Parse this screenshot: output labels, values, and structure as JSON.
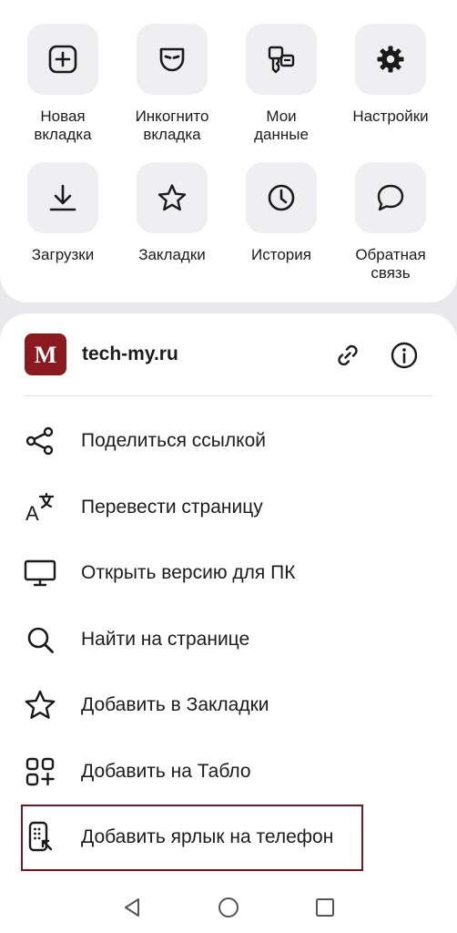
{
  "quick_actions": [
    {
      "label": "Новая\nвкладка",
      "icon": "plus-square-icon"
    },
    {
      "label": "Инкогнито\nвкладка",
      "icon": "mask-icon"
    },
    {
      "label": "Мои\nданные",
      "icon": "key-card-icon"
    },
    {
      "label": "Настройки",
      "icon": "gear-icon"
    },
    {
      "label": "Загрузки",
      "icon": "download-icon"
    },
    {
      "label": "Закладки",
      "icon": "star-icon"
    },
    {
      "label": "История",
      "icon": "clock-icon"
    },
    {
      "label": "Обратная\nсвязь",
      "icon": "chat-bubble-icon"
    }
  ],
  "site": {
    "name": "tech-my.ru",
    "favicon_letter": "M",
    "favicon_color": "#8b1a1f"
  },
  "menu": [
    {
      "label": "Поделиться ссылкой",
      "icon": "share-icon"
    },
    {
      "label": "Перевести страницу",
      "icon": "translate-icon"
    },
    {
      "label": "Открыть версию для ПК",
      "icon": "desktop-icon"
    },
    {
      "label": "Найти на странице",
      "icon": "search-icon"
    },
    {
      "label": "Добавить в Закладки",
      "icon": "star-outline-icon"
    },
    {
      "label": "Добавить на Табло",
      "icon": "grid-add-icon"
    },
    {
      "label": "Добавить ярлык на телефон",
      "icon": "phone-shortcut-icon",
      "highlighted": true
    }
  ],
  "colors": {
    "highlight_border": "#7b1424",
    "background": "#e9e9ec"
  }
}
